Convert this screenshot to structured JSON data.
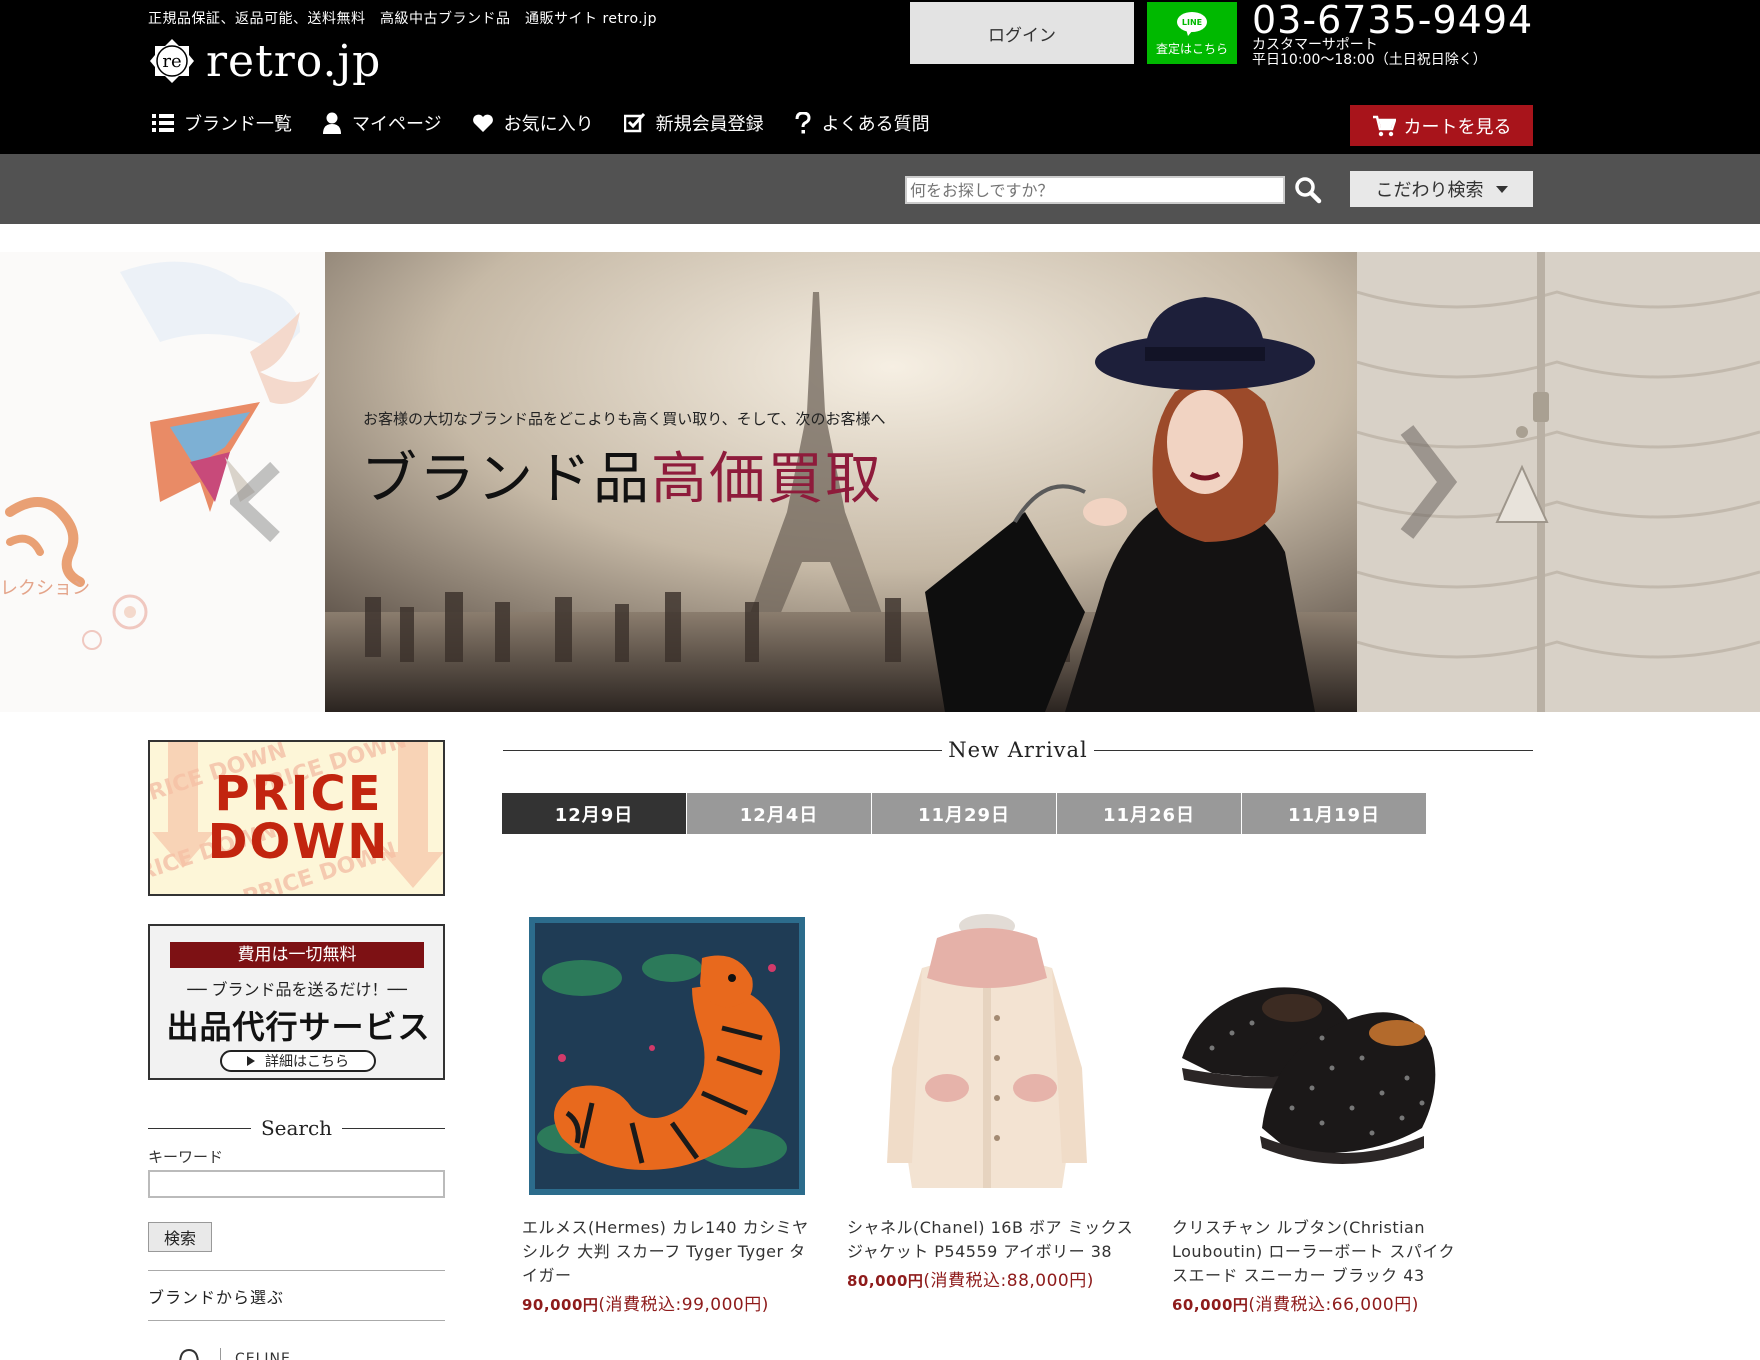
{
  "header": {
    "tagline": "正規品保証、返品可能、送料無料　高級中古ブランド品　通販サイト retro.jp",
    "logo_mark": "re",
    "logo_text": "retro.jp",
    "login_label": "ログイン",
    "line_icon_text": "LINE",
    "line_label": "査定はこちら",
    "phone": "03-6735-9494",
    "support_line1": "カスタマーサポート",
    "support_line2": "平日10:00～18:00（土日祝日除く）",
    "nav": [
      {
        "label": "ブランド一覧",
        "icon": "list-icon"
      },
      {
        "label": "マイページ",
        "icon": "user-icon"
      },
      {
        "label": "お気に入り",
        "icon": "heart-icon"
      },
      {
        "label": "新規会員登録",
        "icon": "checkbox-icon"
      },
      {
        "label": "よくある質問",
        "icon": "question-icon"
      }
    ],
    "cart_label": "カートを見る"
  },
  "search": {
    "placeholder": "何をお探しですか？",
    "advanced_label": "こだわり検索"
  },
  "hero": {
    "left_text": "レクション",
    "subtitle": "お客様の大切なブランド品をどこよりも高く買い取り、そして、次のお客様へ",
    "title_part1": "ブランド品",
    "title_part2": "高価買取",
    "accent_color": "#8e1b3b"
  },
  "sidebar": {
    "price_down_line1": "PRICE",
    "price_down_line2": "DOWN",
    "price_down_watermark": "PRICE DOWN",
    "service_free": "費用は一切無料",
    "service_send": "── ブランド品を送るだけ！──",
    "service_title": "出品代行サービス",
    "service_link": "詳細はこちら",
    "search_heading": "Search",
    "keyword_label": "キーワード",
    "keyword_value": "",
    "search_button": "検索",
    "brand_heading": "ブランドから選ぶ",
    "brand_first": "CELINE"
  },
  "new_arrival": {
    "heading": "New Arrival",
    "tabs": [
      "12月9日",
      "12月4日",
      "11月29日",
      "11月26日",
      "11月19日"
    ],
    "active_tab": 0,
    "products": [
      {
        "name": "エルメス(Hermes) カレ140 カシミヤ シルク 大判 スカーフ Tyger Tyger タイガー",
        "price": "90,000円",
        "tax_price": "(消費税込:99,000円)"
      },
      {
        "name": "シャネル(Chanel) 16B ボア ミックス ジャケット P54559 アイボリー 38",
        "price": "80,000円",
        "tax_price": "(消費税込:88,000円)"
      },
      {
        "name": "クリスチャン ルブタン(Christian Louboutin) ローラーボート スパイク スエード スニーカー ブラック 43",
        "price": "60,000円",
        "tax_price": "(消費税込:66,000円)"
      }
    ]
  },
  "colors": {
    "header_bg": "#000000",
    "searchbar_bg": "#525252",
    "cart_red": "#a8141b",
    "price_red": "#8e1b1b",
    "line_green": "#00b900"
  }
}
